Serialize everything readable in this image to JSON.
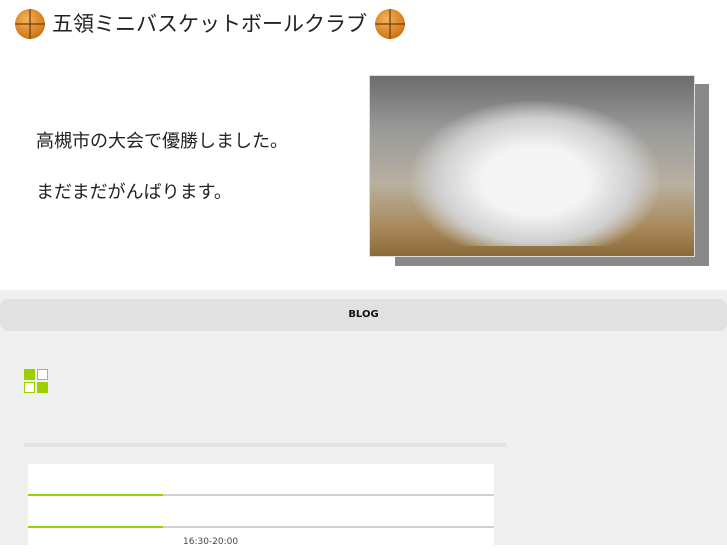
{
  "header": {
    "site_title": "五領ミニバスケットボールクラブ",
    "messages": [
      "高槻市の大会で優勝しました。",
      "まだまだがんばります。"
    ]
  },
  "nav": {
    "blog_label": "BLOG"
  },
  "content": {
    "schedule_time": "16:30-20:00"
  },
  "colors": {
    "accent": "#9cd000",
    "nav_bg": "#e1e1e1",
    "page_bg": "#efefef"
  }
}
